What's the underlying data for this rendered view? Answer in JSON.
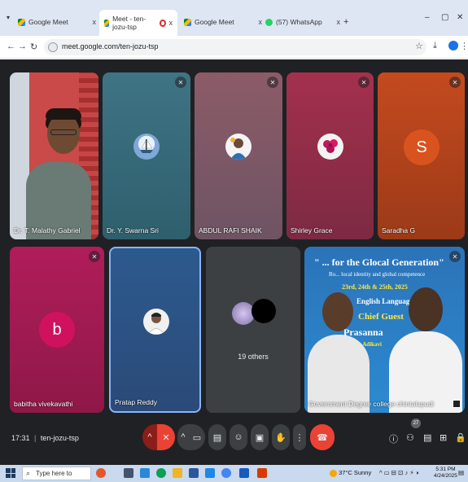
{
  "browser": {
    "tabs": [
      {
        "title": "Google Meet",
        "close": "x",
        "active": false
      },
      {
        "title": "Meet - ten-jozu-tsp",
        "close": "x",
        "active": true
      },
      {
        "title": "Google Meet",
        "close": "x",
        "active": false
      },
      {
        "title": "(57) WhatsApp",
        "close": "x",
        "active": false
      }
    ],
    "new_tab": "+",
    "url": "meet.google.com/ten-jozu-tsp",
    "window_controls": {
      "minimize": "–",
      "restore": "▢",
      "close": "✕"
    }
  },
  "participants": [
    {
      "name": "Dr. T. Malathy Gabriel",
      "muted": false,
      "avatar": "camera-video"
    },
    {
      "name": "Dr. Y. Swarna Sri",
      "muted": true,
      "avatar": "ship-photo"
    },
    {
      "name": "ABDUL RAFI SHAIK",
      "muted": true,
      "avatar": "person-photo"
    },
    {
      "name": "Shirley Grace",
      "muted": true,
      "avatar": "flowers-photo"
    },
    {
      "name": "Saradha G",
      "muted": true,
      "avatar": "S"
    },
    {
      "name": "babitha vivekavathi",
      "muted": true,
      "avatar": "b"
    },
    {
      "name": "Pratap Reddy",
      "muted": false,
      "avatar": "person-photo"
    },
    {
      "name": "19 others",
      "muted": false,
      "avatar": "group"
    },
    {
      "name": "Government Degree college chintalapudi",
      "muted": true,
      "avatar": "camera-video"
    }
  ],
  "banner": {
    "line1": "\" ... for the Glocal Generation\"",
    "line2": "Ro... local identity and global competence",
    "line3": "23rd, 24th & 25th, 2025",
    "line4": "English Language De...",
    "line5": "Chief Guest",
    "line6": "Prasanna",
    "line7": "...Adikavi"
  },
  "meeting": {
    "time": "17:31",
    "separator": "|",
    "code": "ten-jozu-tsp",
    "participant_count": "27"
  },
  "taskbar": {
    "search_placeholder": "Type here to search",
    "weather": "37°C  Sunny",
    "time": "5:31 PM",
    "date": "4/24/2025"
  },
  "colors": {
    "stage_bg": "#202124",
    "end_call": "#ea4335",
    "mic_off": "#8c1d18",
    "active_speaker_border": "#8ab4f8"
  }
}
